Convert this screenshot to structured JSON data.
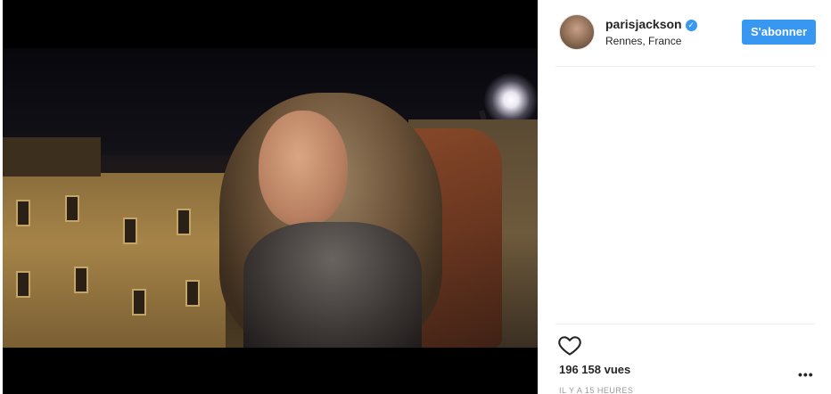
{
  "post": {
    "username": "parisjackson",
    "location": "Rennes, France",
    "follow_label": "S'abonner",
    "views": "196 158 vues",
    "timestamp": "IL Y A 15 HEURES",
    "more_label": "•••"
  },
  "icons": {
    "verified": "verified-badge-icon",
    "like": "heart-icon",
    "more": "more-options-icon"
  },
  "colors": {
    "accent": "#3897f0",
    "text": "#262626",
    "muted": "#999999",
    "divider": "#efefef",
    "video_background": "#000000"
  }
}
